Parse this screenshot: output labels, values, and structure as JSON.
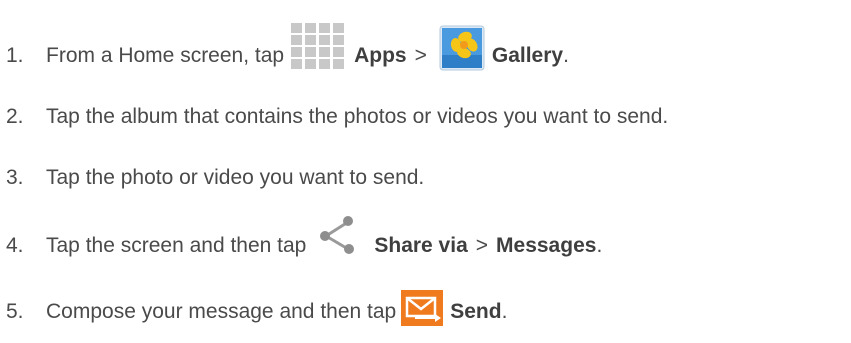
{
  "steps": [
    {
      "number": "1.",
      "parts": {
        "lead": "From a Home screen, tap",
        "apps": "Apps",
        "sep": ">",
        "gallery": "Gallery",
        "end": "."
      },
      "icons": [
        "apps-grid-icon",
        "gallery-icon"
      ]
    },
    {
      "number": "2.",
      "text": "Tap the album that contains the photos or videos you want to send."
    },
    {
      "number": "3.",
      "text": "Tap the photo or video you want to send."
    },
    {
      "number": "4.",
      "parts": {
        "lead": "Tap the screen and then tap",
        "share": "Share via",
        "sep": ">",
        "messages": "Messages",
        "end": "."
      },
      "icons": [
        "share-icon"
      ]
    },
    {
      "number": "5.",
      "parts": {
        "lead": "Compose your message and then tap",
        "send": "Send",
        "end": "."
      },
      "icons": [
        "send-message-icon"
      ]
    }
  ],
  "colors": {
    "text": "#4a4a4a",
    "apps_icon": "#c8c8c8",
    "gallery_blue": "#3a8ed8",
    "gallery_yellow": "#f5c518",
    "send_orange": "#f07a1e"
  }
}
